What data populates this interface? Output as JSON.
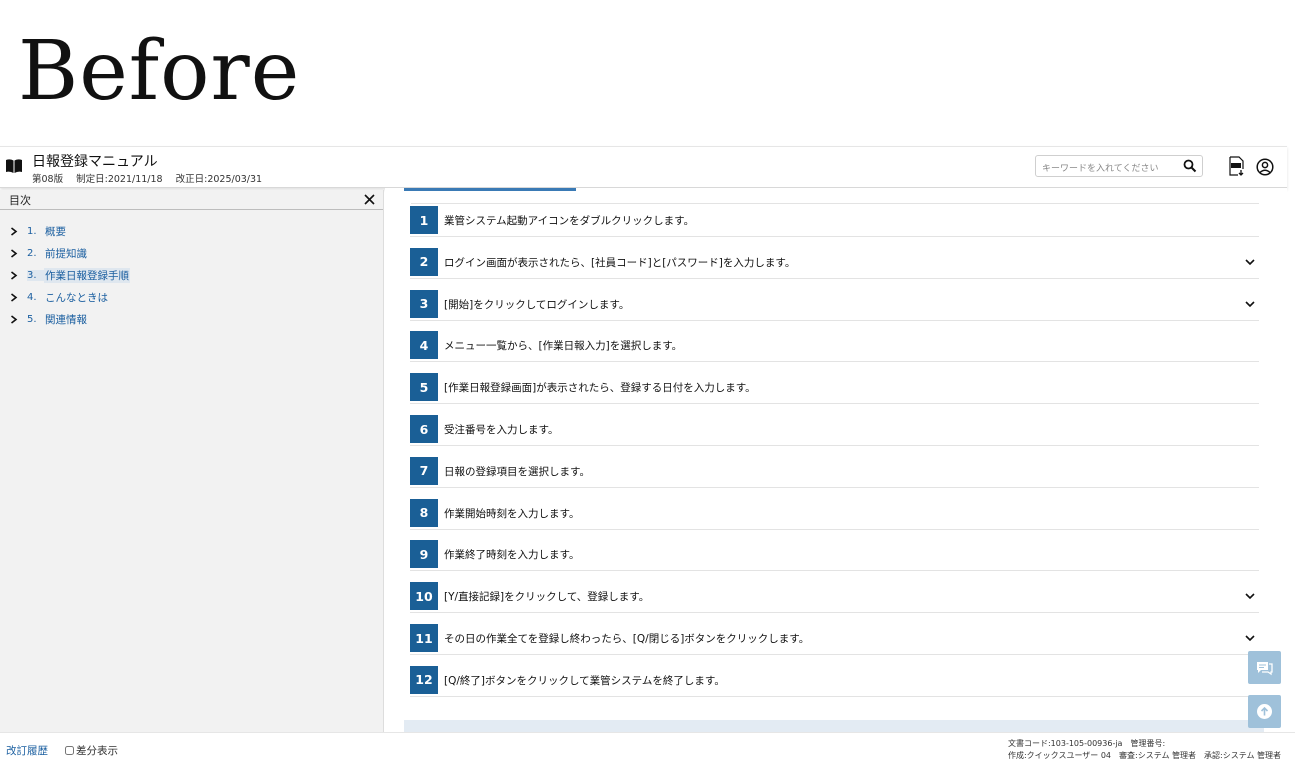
{
  "overlay_label": "Before",
  "header": {
    "title": "日報登録マニュアル",
    "edition": "第08版",
    "created": "制定日:2021/11/18",
    "revised": "改正日:2025/03/31",
    "search_placeholder": "キーワードを入れてください",
    "icons": {
      "book": "book-icon",
      "search": "search-icon",
      "pdf": "pdf-download-icon",
      "user": "user-account-icon"
    }
  },
  "toc": {
    "heading": "目次",
    "items": [
      {
        "num": "1.",
        "label": "概要",
        "active": false
      },
      {
        "num": "2.",
        "label": "前提知識",
        "active": false
      },
      {
        "num": "3.",
        "label": "作業日報登録手順",
        "active": true
      },
      {
        "num": "4.",
        "label": "こんなときは",
        "active": false
      },
      {
        "num": "5.",
        "label": "関連情報",
        "active": false
      }
    ]
  },
  "steps": [
    {
      "num": "1",
      "text": "業管システム起動アイコンをダブルクリックします。",
      "expandable": false
    },
    {
      "num": "2",
      "text": "ログイン画面が表示されたら、[社員コード]と[パスワード]を入力します。",
      "expandable": true
    },
    {
      "num": "3",
      "text": "[開始]をクリックしてログインします。",
      "expandable": true
    },
    {
      "num": "4",
      "text": "メニュー一覧から、[作業日報入力]を選択します。",
      "expandable": false
    },
    {
      "num": "5",
      "text": "[作業日報登録画面]が表示されたら、登録する日付を入力します。",
      "expandable": false
    },
    {
      "num": "6",
      "text": "受注番号を入力します。",
      "expandable": false
    },
    {
      "num": "7",
      "text": "日報の登録項目を選択します。",
      "expandable": false
    },
    {
      "num": "8",
      "text": "作業開始時刻を入力します。",
      "expandable": false
    },
    {
      "num": "9",
      "text": "作業終了時刻を入力します。",
      "expandable": false
    },
    {
      "num": "10",
      "text": "[Y/直接記録]をクリックして、登録します。",
      "expandable": true
    },
    {
      "num": "11",
      "text": "その日の作業全てを登録し終わったら、[Q/閉じる]ボタンをクリックします。",
      "expandable": true
    },
    {
      "num": "12",
      "text": "[Q/終了]ボタンをクリックして業管システムを終了します。",
      "expandable": false
    }
  ],
  "floating": {
    "feedback_icon": "feedback-chat-icon",
    "top_icon": "arrow-up-icon"
  },
  "footer": {
    "revision_history": "改訂履歴",
    "diff_display": "差分表示",
    "doc_line1": "文書コード:103-105-00936-ja　管理番号:",
    "doc_line2": "作成:クイックスユーザー 04　審査:システム 管理者　承認:システム 管理者"
  },
  "colors": {
    "accent": "#1a5f96",
    "link": "#1b5fa0",
    "sidebar_bg": "#f2f2f2",
    "floating_btn": "#9fc1da"
  }
}
